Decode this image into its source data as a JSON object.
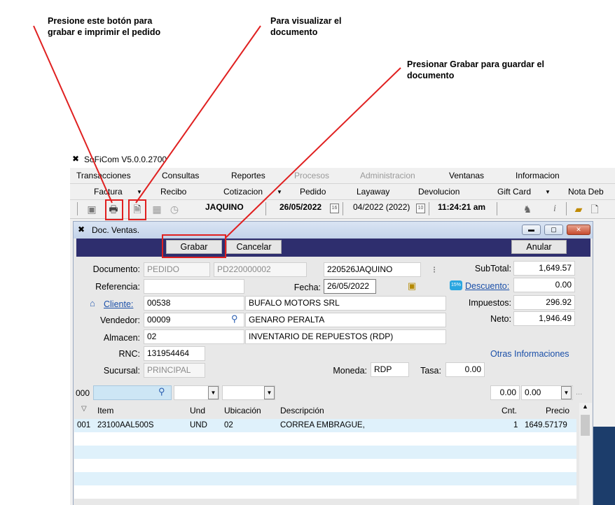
{
  "annotations": {
    "print_note": "Presione este botón para\ngrabar e imprimir el pedido",
    "view_note": "Para visualizar el\ndocumento",
    "save_note": "Presionar Grabar para guardar el\ndocumento"
  },
  "app": {
    "title": "SoFiCom V5.0.0.2700",
    "menu": [
      "Transacciones",
      "Consultas",
      "Reportes",
      "Procesos",
      "Administracion",
      "Ventanas",
      "Informacion"
    ],
    "submenu": [
      "Factura",
      "Recibo",
      "Cotizacion",
      "Pedido",
      "Layaway",
      "Devolucion",
      "Gift Card",
      "Nota Deb"
    ],
    "toolbar": {
      "user": "JAQUINO",
      "date": "26/05/2022",
      "period": "04/2022 (2022)",
      "time": "11:24:21 am",
      "cal1": "16",
      "cal2": "10"
    }
  },
  "window": {
    "title": "Doc. Ventas.",
    "buttons": {
      "save": "Grabar",
      "cancel": "Cancelar",
      "void": "Anular"
    },
    "form": {
      "documento_label": "Documento:",
      "documento": "PEDIDO",
      "doc_number": "PD220000002",
      "doc_ref": "220526JAQUINO",
      "referencia_label": "Referencia:",
      "referencia": "",
      "fecha_label": "Fecha:",
      "fecha": "26/05/2022",
      "cliente_label": "Cliente:",
      "cliente_code": "00538",
      "cliente_name": "BUFALO MOTORS SRL",
      "vendedor_label": "Vendedor:",
      "vendedor_code": "00009",
      "vendedor_name": "GENARO PERALTA",
      "almacen_label": "Almacen:",
      "almacen_code": "02",
      "almacen_name": "INVENTARIO DE REPUESTOS (RDP)",
      "rnc_label": "RNC:",
      "rnc": "131954464",
      "sucursal_label": "Sucursal:",
      "sucursal": "PRINCIPAL",
      "moneda_label": "Moneda:",
      "moneda": "RDP",
      "tasa_label": "Tasa:",
      "tasa": "0.00",
      "otras": "Otras Informaciones"
    },
    "totals": {
      "subtotal_label": "SubTotal:",
      "subtotal": "1,649.57",
      "descuento_badge": "15%",
      "descuento_label": "Descuento:",
      "descuento": "0.00",
      "impuestos_label": "Impuestos:",
      "impuestos": "296.92",
      "neto_label": "Neto:",
      "neto": "1,946.49"
    },
    "entry": {
      "line": "000",
      "qty": "0.00",
      "price": "0.00",
      "more": "..."
    },
    "grid": {
      "columns": [
        "Item",
        "Und",
        "Ubicación",
        "Descripción",
        "Cnt.",
        "Precio"
      ],
      "rows": [
        {
          "n": "001",
          "item": "23100AAL500S",
          "und": "UND",
          "ubic": "02",
          "desc": "CORREA EMBRAGUE,",
          "cnt": "1",
          "precio": "1649.57179"
        }
      ]
    }
  }
}
